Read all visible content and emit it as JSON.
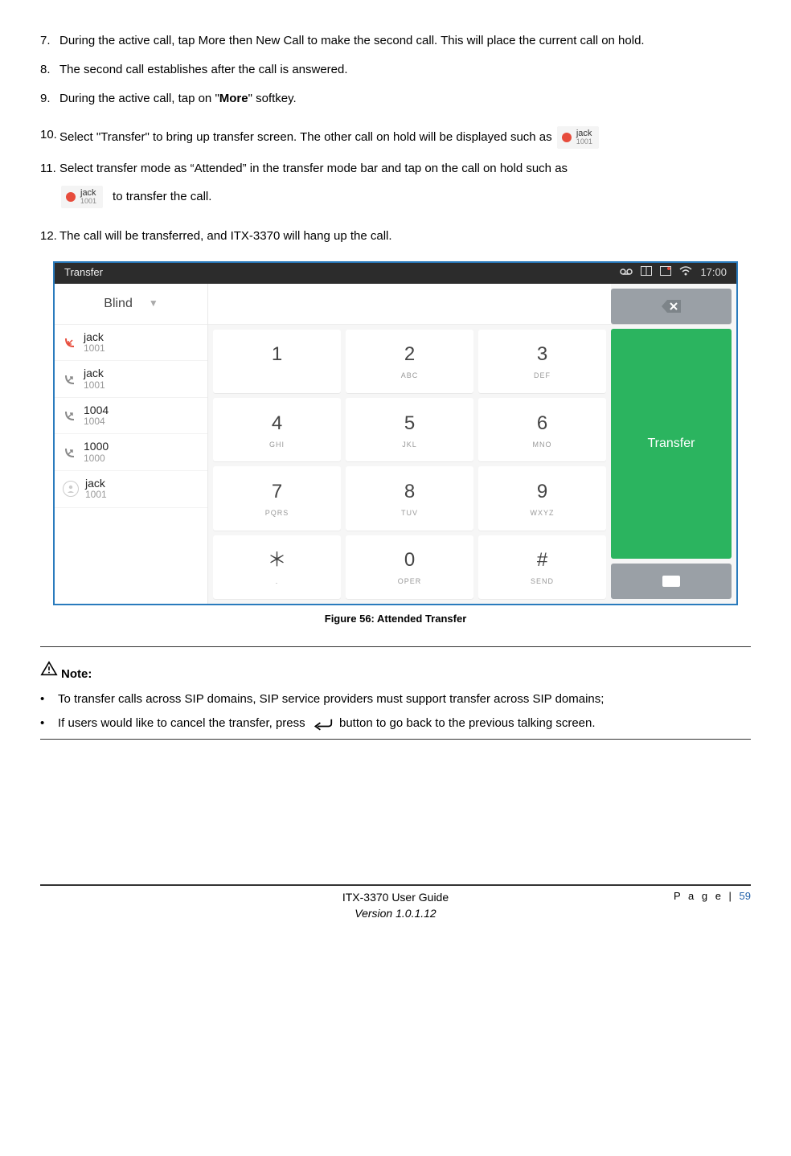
{
  "steps": {
    "s7_num": "7.",
    "s7": "During the active call, tap More then New Call to make the second call. This will place the current call on hold.",
    "s8_num": "8.",
    "s8": "The second call establishes after the call is answered.",
    "s9_num": "9.",
    "s9a": "During the active call, tap on \"",
    "s9b": "More",
    "s9c": "\" softkey.",
    "s10_num": "10.",
    "s10": "Select \"Transfer\" to bring up transfer screen. The other call on hold will be displayed such as",
    "s11_num": "11.",
    "s11a": "Select transfer mode as “Attended” in the transfer mode bar and tap on the call on hold such as",
    "s11b": "to transfer the call.",
    "s12_num": "12.",
    "s12": "The call will be transferred, and ITX-3370 will hang up the call."
  },
  "badge": {
    "name": "jack",
    "ext": "1001"
  },
  "screenshot": {
    "title": "Transfer",
    "time": "17:00",
    "mode": "Blind",
    "calls": [
      {
        "name": "jack",
        "ext": "1001",
        "dir": "in"
      },
      {
        "name": "jack",
        "ext": "1001",
        "dir": "out"
      },
      {
        "name": "1004",
        "ext": "1004",
        "dir": "out"
      },
      {
        "name": "1000",
        "ext": "1000",
        "dir": "out"
      },
      {
        "name": "jack",
        "ext": "1001",
        "dir": "contact"
      }
    ],
    "keys": [
      {
        "d": "1",
        "s": ""
      },
      {
        "d": "2",
        "s": "ABC"
      },
      {
        "d": "3",
        "s": "DEF"
      },
      {
        "d": "4",
        "s": "GHI"
      },
      {
        "d": "5",
        "s": "JKL"
      },
      {
        "d": "6",
        "s": "MNO"
      },
      {
        "d": "7",
        "s": "PQRS"
      },
      {
        "d": "8",
        "s": "TUV"
      },
      {
        "d": "9",
        "s": "WXYZ"
      },
      {
        "d": "＊",
        "s": "."
      },
      {
        "d": "0",
        "s": "OPER"
      },
      {
        "d": "#",
        "s": "SEND"
      }
    ],
    "transfer_label": "Transfer"
  },
  "figure_caption": "Figure 56: Attended Transfer",
  "note": {
    "heading": "Note:",
    "b1": "To transfer calls across SIP domains, SIP service providers must support transfer across SIP domains;",
    "b2a": "If users would like to cancel the transfer, press",
    "b2b": "button to go back to the previous talking screen."
  },
  "footer": {
    "guide": "ITX-3370 User Guide",
    "version": "Version 1.0.1.12",
    "page_label": "P a g e | ",
    "page_num": "59"
  }
}
